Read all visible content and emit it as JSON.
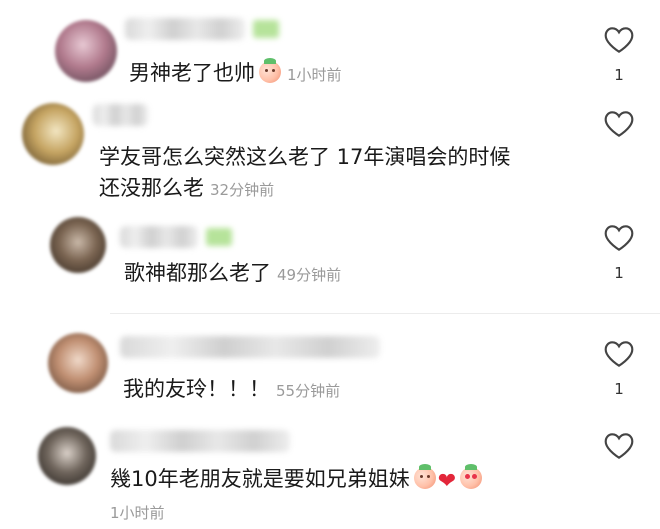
{
  "comments": [
    {
      "text": "男神老了也帅",
      "time": "1小时前",
      "likes": "1"
    },
    {
      "text_line1": "学友哥怎么突然这么老了 17年演唱会的时候",
      "text_line2": "还没那么老",
      "time": "32分钟前",
      "likes": ""
    },
    {
      "text": "歌神都那么老了",
      "time": "49分钟前",
      "likes": "1"
    },
    {
      "text": "我的友玲！！！",
      "time": "55分钟前",
      "likes": "1"
    },
    {
      "text": "幾10年老朋友就是要如兄弟姐妹",
      "time": "1小时前",
      "likes": ""
    }
  ],
  "icons": {
    "like": "heart-outline-icon"
  },
  "colors": {
    "time": "#9a9a9a",
    "heart": "#e3263a"
  }
}
